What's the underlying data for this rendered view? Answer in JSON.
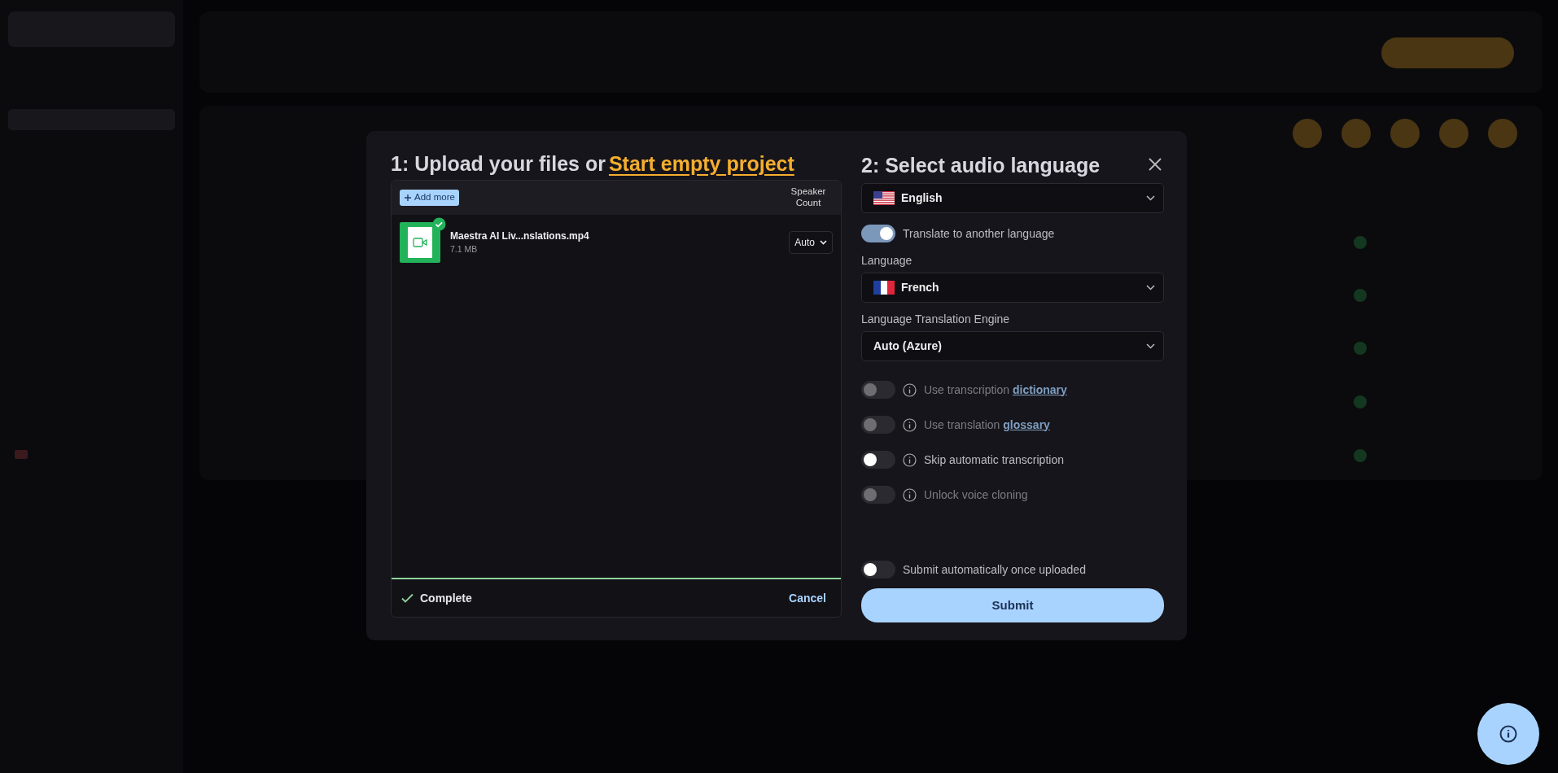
{
  "dialog": {
    "upload": {
      "title": "1: Upload your files or",
      "link": "Start empty project",
      "add_more": "Add more",
      "speaker_header": "Speaker Count",
      "files": [
        {
          "name": "Maestra AI Liv...nslations.mp4",
          "size": "7.1 MB",
          "speakers": "Auto",
          "uploaded": true
        }
      ],
      "progress": {
        "level": 1,
        "status": "Complete"
      },
      "cancel": "Cancel"
    },
    "language": {
      "title": "2: Select audio language",
      "source": "English",
      "translate": {
        "label": "Translate to another language",
        "checked": true
      },
      "target_label": "Language",
      "target": "French",
      "engine_label": "Language Translation Engine",
      "engine": "Auto (Azure)",
      "options": [
        {
          "text": "Use transcription",
          "link": "dictionary",
          "checked": false,
          "disabled": true
        },
        {
          "text": "Use translation",
          "link": "glossary",
          "checked": false,
          "disabled": true
        },
        {
          "text": "Skip automatic transcription",
          "checked": false,
          "disabled": false
        },
        {
          "text": "Unlock voice cloning",
          "checked": false,
          "disabled": true
        }
      ],
      "auto_submit": {
        "label": "Submit automatically once uploaded",
        "checked": false
      },
      "submit": "Submit"
    }
  }
}
